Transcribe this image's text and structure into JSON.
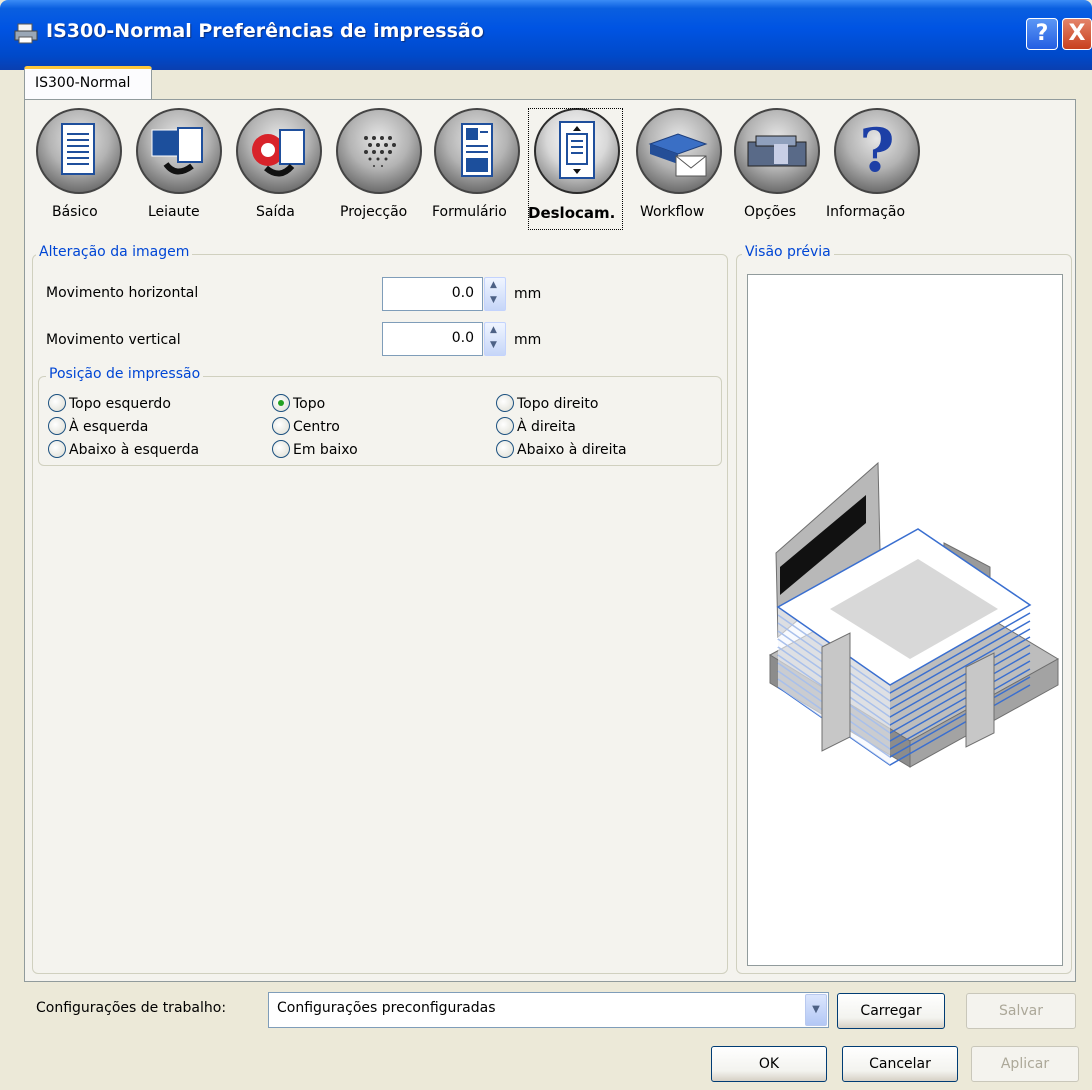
{
  "window": {
    "title": "IS300-Normal Preferências de impressão",
    "help_label": "?",
    "close_label": "X"
  },
  "tab": {
    "label": "IS300-Normal"
  },
  "toolbar": [
    {
      "label": "Básico",
      "icon": "document-icon"
    },
    {
      "label": "Leiaute",
      "icon": "layout-icon"
    },
    {
      "label": "Saída",
      "icon": "output-icon"
    },
    {
      "label": "Projecção",
      "icon": "halftone-icon"
    },
    {
      "label": "Formulário",
      "icon": "form-icon"
    },
    {
      "label": "Deslocam.",
      "icon": "shift-icon",
      "selected": true
    },
    {
      "label": "Workflow",
      "icon": "workflow-icon"
    },
    {
      "label": "Opções",
      "icon": "options-icon"
    },
    {
      "label": "Informação",
      "icon": "info-icon",
      "glyph": "?"
    }
  ],
  "image_shift": {
    "title": "Alteração da imagem",
    "horizontal": {
      "label": "Movimento horizontal",
      "value": "0.0",
      "unit": "mm"
    },
    "vertical": {
      "label": "Movimento vertical",
      "value": "0.0",
      "unit": "mm"
    },
    "print_position": {
      "title": "Posição de impressão",
      "options": [
        {
          "label": "Topo esquerdo",
          "selected": false
        },
        {
          "label": "Topo",
          "selected": true
        },
        {
          "label": "Topo direito",
          "selected": false
        },
        {
          "label": "À esquerda",
          "selected": false
        },
        {
          "label": "Centro",
          "selected": false
        },
        {
          "label": "À direita",
          "selected": false
        },
        {
          "label": "Abaixo à esquerda",
          "selected": false
        },
        {
          "label": "Em baixo",
          "selected": false
        },
        {
          "label": "Abaixo à direita",
          "selected": false
        }
      ]
    }
  },
  "preview": {
    "title": "Visão prévia"
  },
  "job_settings": {
    "label": "Configurações de trabalho:",
    "value": "Configurações preconfiguradas",
    "load_label": "Carregar",
    "save_label": "Salvar"
  },
  "buttons": {
    "ok": "OK",
    "cancel": "Cancelar",
    "apply": "Aplicar"
  },
  "colors": {
    "titlebar": "#0054e3",
    "group_title": "#0046d5",
    "background": "#ece9d8"
  }
}
